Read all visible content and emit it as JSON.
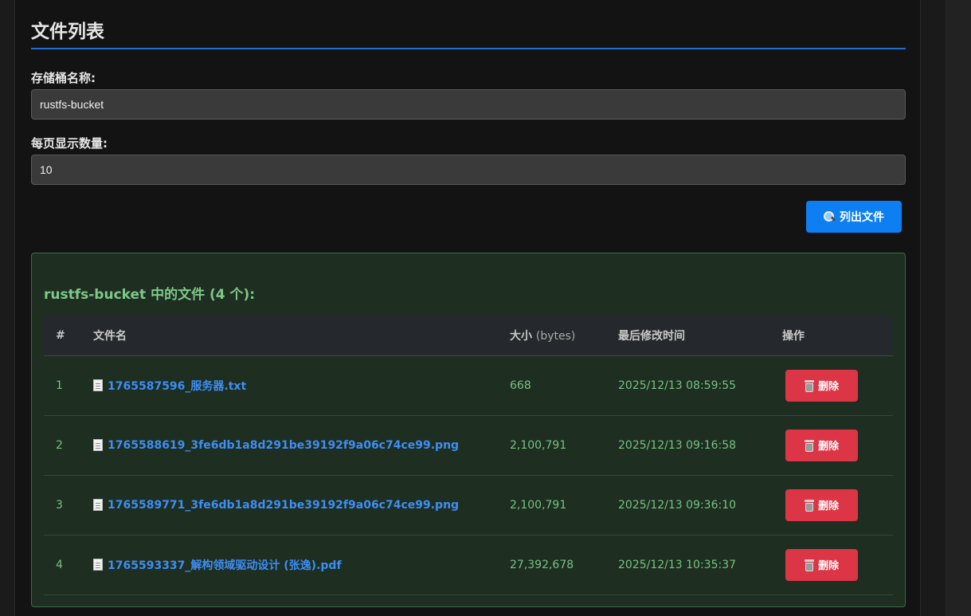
{
  "page": {
    "title": "文件列表"
  },
  "form": {
    "bucket_label": "存储桶名称:",
    "bucket_value": "rustfs-bucket",
    "page_size_label": "每页显示数量:",
    "page_size_value": "10",
    "list_button_label": "列出文件"
  },
  "results": {
    "heading": "rustfs-bucket 中的文件 (4 个):",
    "columns": {
      "index": "#",
      "name": "文件名",
      "size": "大小",
      "size_unit": "(bytes)",
      "modified": "最后修改时间",
      "actions": "操作"
    },
    "rows": [
      {
        "index": "1",
        "name": "1765587596_服务器.txt",
        "size": "668",
        "modified": "2025/12/13 08:59:55",
        "delete_label": "删除"
      },
      {
        "index": "2",
        "name": "1765588619_3fe6db1a8d291be39192f9a06c74ce99.png",
        "size": "2,100,791",
        "modified": "2025/12/13 09:16:58",
        "delete_label": "删除"
      },
      {
        "index": "3",
        "name": "1765589771_3fe6db1a8d291be39192f9a06c74ce99.png",
        "size": "2,100,791",
        "modified": "2025/12/13 09:36:10",
        "delete_label": "删除"
      },
      {
        "index": "4",
        "name": "1765593337_解构领域驱动设计 (张逸).pdf",
        "size": "27,392,678",
        "modified": "2025/12/13 10:35:37",
        "delete_label": "删除"
      }
    ]
  },
  "colors": {
    "accent": "#0d7ff2",
    "danger": "#dc3545",
    "success_text": "#7ec889",
    "link": "#3d8ef5"
  }
}
